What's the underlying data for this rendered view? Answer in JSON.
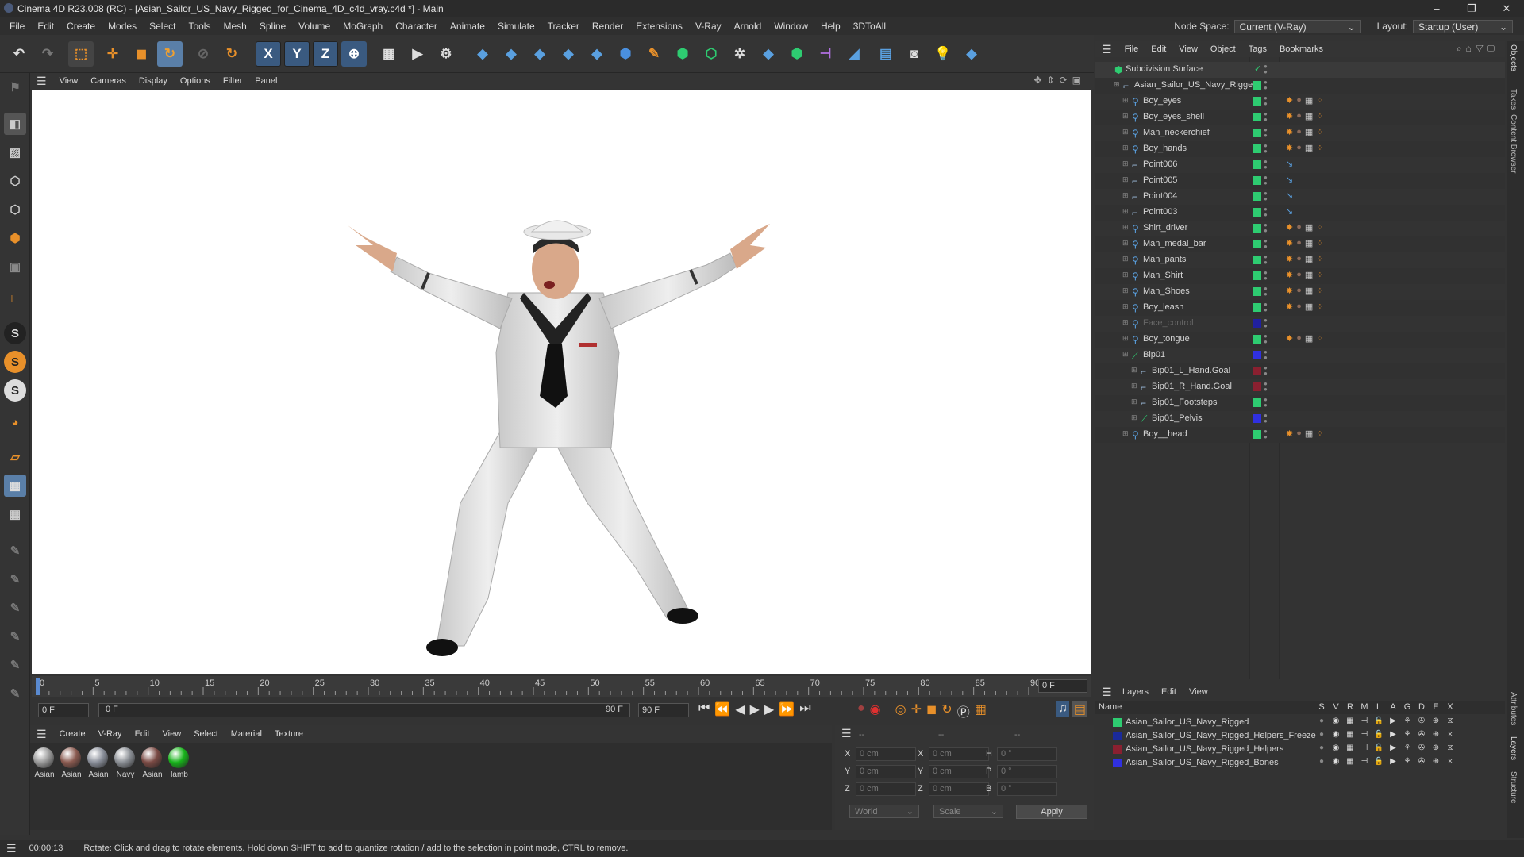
{
  "window": {
    "title": "Cinema 4D R23.008 (RC) - [Asian_Sailor_US_Navy_Rigged_for_Cinema_4D_c4d_vray.c4d *] - Main",
    "controls": [
      "–",
      "❐",
      "✕"
    ]
  },
  "menu": {
    "items": [
      "File",
      "Edit",
      "Create",
      "Modes",
      "Select",
      "Tools",
      "Mesh",
      "Spline",
      "Volume",
      "MoGraph",
      "Character",
      "Animate",
      "Simulate",
      "Tracker",
      "Render",
      "Extensions",
      "V-Ray",
      "Arnold",
      "Window",
      "Help",
      "3DToAll"
    ],
    "node_space_label": "Node Space:",
    "node_space_value": "Current (V-Ray)",
    "layout_label": "Layout:",
    "layout_value": "Startup (User)"
  },
  "toolbar": {
    "x": "X",
    "y": "Y",
    "z": "Z"
  },
  "viewport_menu": [
    "View",
    "Cameras",
    "Display",
    "Options",
    "Filter",
    "Panel"
  ],
  "timeline": {
    "ticks": [
      "0",
      "5",
      "10",
      "15",
      "20",
      "25",
      "30",
      "35",
      "40",
      "45",
      "50",
      "55",
      "60",
      "65",
      "70",
      "75",
      "80",
      "85",
      "90"
    ],
    "end_frame": "0 F"
  },
  "transport": {
    "current": "0 F",
    "start": "0 F",
    "range_end": "90 F",
    "end": "90 F"
  },
  "material_menu": [
    "Create",
    "V-Ray",
    "Edit",
    "View",
    "Select",
    "Material",
    "Texture"
  ],
  "materials": [
    {
      "label": "Asian",
      "color": "#9a9a9a"
    },
    {
      "label": "Asian",
      "color": "#8a5a50"
    },
    {
      "label": "Asian",
      "color": "#8a8f9a"
    },
    {
      "label": "Navy",
      "color": "#8a8e94"
    },
    {
      "label": "Asian",
      "color": "#7a4a44"
    },
    {
      "label": "lamb",
      "color": "#17b31a"
    }
  ],
  "coords": {
    "head": [
      "--",
      "--",
      "--"
    ],
    "rows": [
      {
        "a": "X",
        "av": "0 cm",
        "b": "X",
        "bv": "0 cm",
        "c": "H",
        "cv": "0 °"
      },
      {
        "a": "Y",
        "av": "0 cm",
        "b": "Y",
        "bv": "0 cm",
        "c": "P",
        "cv": "0 °"
      },
      {
        "a": "Z",
        "av": "0 cm",
        "b": "Z",
        "bv": "0 cm",
        "c": "B",
        "cv": "0 °"
      }
    ],
    "world": "World",
    "scale": "Scale",
    "apply": "Apply"
  },
  "status": {
    "time": "00:00:13",
    "text": "Rotate: Click and drag to rotate elements. Hold down SHIFT to add to quantize rotation / add to the selection in point mode, CTRL to remove."
  },
  "objects_menu": [
    "File",
    "Edit",
    "View",
    "Object",
    "Tags",
    "Bookmarks"
  ],
  "objects": [
    {
      "name": "Subdivision Surface",
      "indent": 0,
      "color": "",
      "kind": "sub"
    },
    {
      "name": "Asian_Sailor_US_Navy_Rigged",
      "indent": 1,
      "color": "#2ecc71",
      "kind": "null"
    },
    {
      "name": "Boy_eyes",
      "indent": 2,
      "color": "#2ecc71",
      "kind": "joint"
    },
    {
      "name": "Boy_eyes_shell",
      "indent": 2,
      "color": "#2ecc71",
      "kind": "joint"
    },
    {
      "name": "Man_neckerchief",
      "indent": 2,
      "color": "#2ecc71",
      "kind": "joint"
    },
    {
      "name": "Boy_hands",
      "indent": 2,
      "color": "#2ecc71",
      "kind": "joint"
    },
    {
      "name": "Point006",
      "indent": 2,
      "color": "#2ecc71",
      "kind": "null"
    },
    {
      "name": "Point005",
      "indent": 2,
      "color": "#2ecc71",
      "kind": "null"
    },
    {
      "name": "Point004",
      "indent": 2,
      "color": "#2ecc71",
      "kind": "null"
    },
    {
      "name": "Point003",
      "indent": 2,
      "color": "#2ecc71",
      "kind": "null"
    },
    {
      "name": "Shirt_driver",
      "indent": 2,
      "color": "#2ecc71",
      "kind": "joint"
    },
    {
      "name": "Man_medal_bar",
      "indent": 2,
      "color": "#2ecc71",
      "kind": "joint"
    },
    {
      "name": "Man_pants",
      "indent": 2,
      "color": "#2ecc71",
      "kind": "joint"
    },
    {
      "name": "Man_Shirt",
      "indent": 2,
      "color": "#2ecc71",
      "kind": "joint"
    },
    {
      "name": "Man_Shoes",
      "indent": 2,
      "color": "#2ecc71",
      "kind": "joint"
    },
    {
      "name": "Boy_leash",
      "indent": 2,
      "color": "#2ecc71",
      "kind": "joint"
    },
    {
      "name": "Face_control",
      "indent": 2,
      "color": "#2020a0",
      "kind": "joint",
      "dim": true
    },
    {
      "name": "Boy_tongue",
      "indent": 2,
      "color": "#2ecc71",
      "kind": "joint"
    },
    {
      "name": "Bip01",
      "indent": 2,
      "color": "#3030e0",
      "kind": "bone"
    },
    {
      "name": "Bip01_L_Hand.Goal",
      "indent": 3,
      "color": "#8a2030",
      "kind": "null"
    },
    {
      "name": "Bip01_R_Hand.Goal",
      "indent": 3,
      "color": "#8a2030",
      "kind": "null"
    },
    {
      "name": "Bip01_Footsteps",
      "indent": 3,
      "color": "#2ecc71",
      "kind": "null"
    },
    {
      "name": "Bip01_Pelvis",
      "indent": 3,
      "color": "#3030e0",
      "kind": "bone"
    },
    {
      "name": "Boy__head",
      "indent": 2,
      "color": "#2ecc71",
      "kind": "joint"
    }
  ],
  "layers_menu": [
    "Layers",
    "Edit",
    "View"
  ],
  "layers_header": {
    "name": "Name",
    "cols": [
      "S",
      "V",
      "R",
      "M",
      "L",
      "A",
      "G",
      "D",
      "E",
      "X"
    ]
  },
  "layers": [
    {
      "name": "Asian_Sailor_US_Navy_Rigged",
      "color": "#2ecc71"
    },
    {
      "name": "Asian_Sailor_US_Navy_Rigged_Helpers_Freeze",
      "color": "#1a2a9a"
    },
    {
      "name": "Asian_Sailor_US_Navy_Rigged_Helpers",
      "color": "#8a2030"
    },
    {
      "name": "Asian_Sailor_US_Navy_Rigged_Bones",
      "color": "#3030e0"
    }
  ],
  "side_tabs": [
    "Objects",
    "Takes",
    "Content Browser",
    "Attributes",
    "Layers",
    "Structure"
  ]
}
